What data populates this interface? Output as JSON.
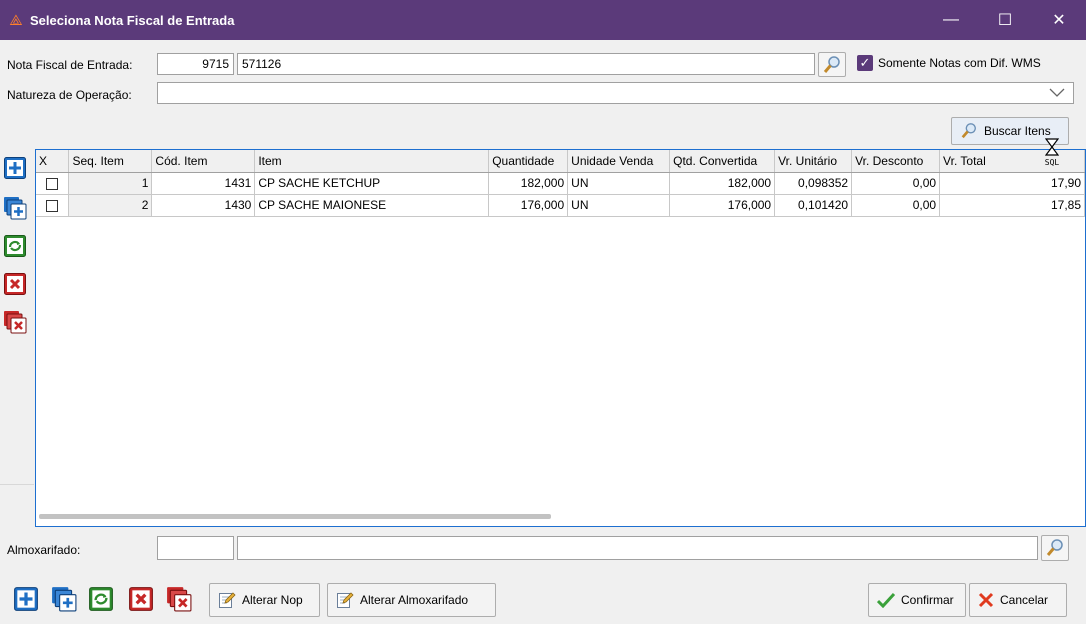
{
  "window": {
    "title": "Seleciona Nota Fiscal de Entrada",
    "minimize": "—",
    "maximize": "☐",
    "close": "✕"
  },
  "form": {
    "nota_label": "Nota Fiscal de Entrada:",
    "nota_number": "9715",
    "nota_series": "571126",
    "somente_label": "Somente Notas com Dif. WMS",
    "somente_checked": true,
    "natureza_label": "Natureza de Operação:",
    "natureza_value": "",
    "buscar_label": "Buscar Itens",
    "sql_label": "SQL"
  },
  "grid": {
    "columns": [
      "X",
      "Seq. Item",
      "Cód. Item",
      "Item",
      "Quantidade",
      "Unidade Venda",
      "Qtd. Convertida",
      "Vr. Unitário",
      "Vr. Desconto",
      "Vr. Total"
    ],
    "rows": [
      {
        "checked": false,
        "seq": "1",
        "cod": "1431",
        "item": "CP SACHE KETCHUP",
        "qtd": "182,000",
        "un": "UN",
        "qtd_conv": "182,000",
        "vr_unit": "0,098352",
        "vr_desc": "0,00",
        "vr_total": "17,90"
      },
      {
        "checked": false,
        "seq": "2",
        "cod": "1430",
        "item": "CP SACHE MAIONESE",
        "qtd": "176,000",
        "un": "UN",
        "qtd_conv": "176,000",
        "vr_unit": "0,101420",
        "vr_desc": "0,00",
        "vr_total": "17,85"
      }
    ]
  },
  "almox": {
    "label": "Almoxarifado:",
    "code": "",
    "name": ""
  },
  "buttons": {
    "alterar_nop": "Alterar Nop",
    "alterar_almox": "Alterar Almoxarifado",
    "confirmar": "Confirmar",
    "cancelar": "Cancelar"
  },
  "colors": {
    "titlebar": "#5b3a7a",
    "grid_border": "#1d6fd0",
    "confirm_green": "#3aa13a",
    "cancel_red": "#e03a1e"
  }
}
